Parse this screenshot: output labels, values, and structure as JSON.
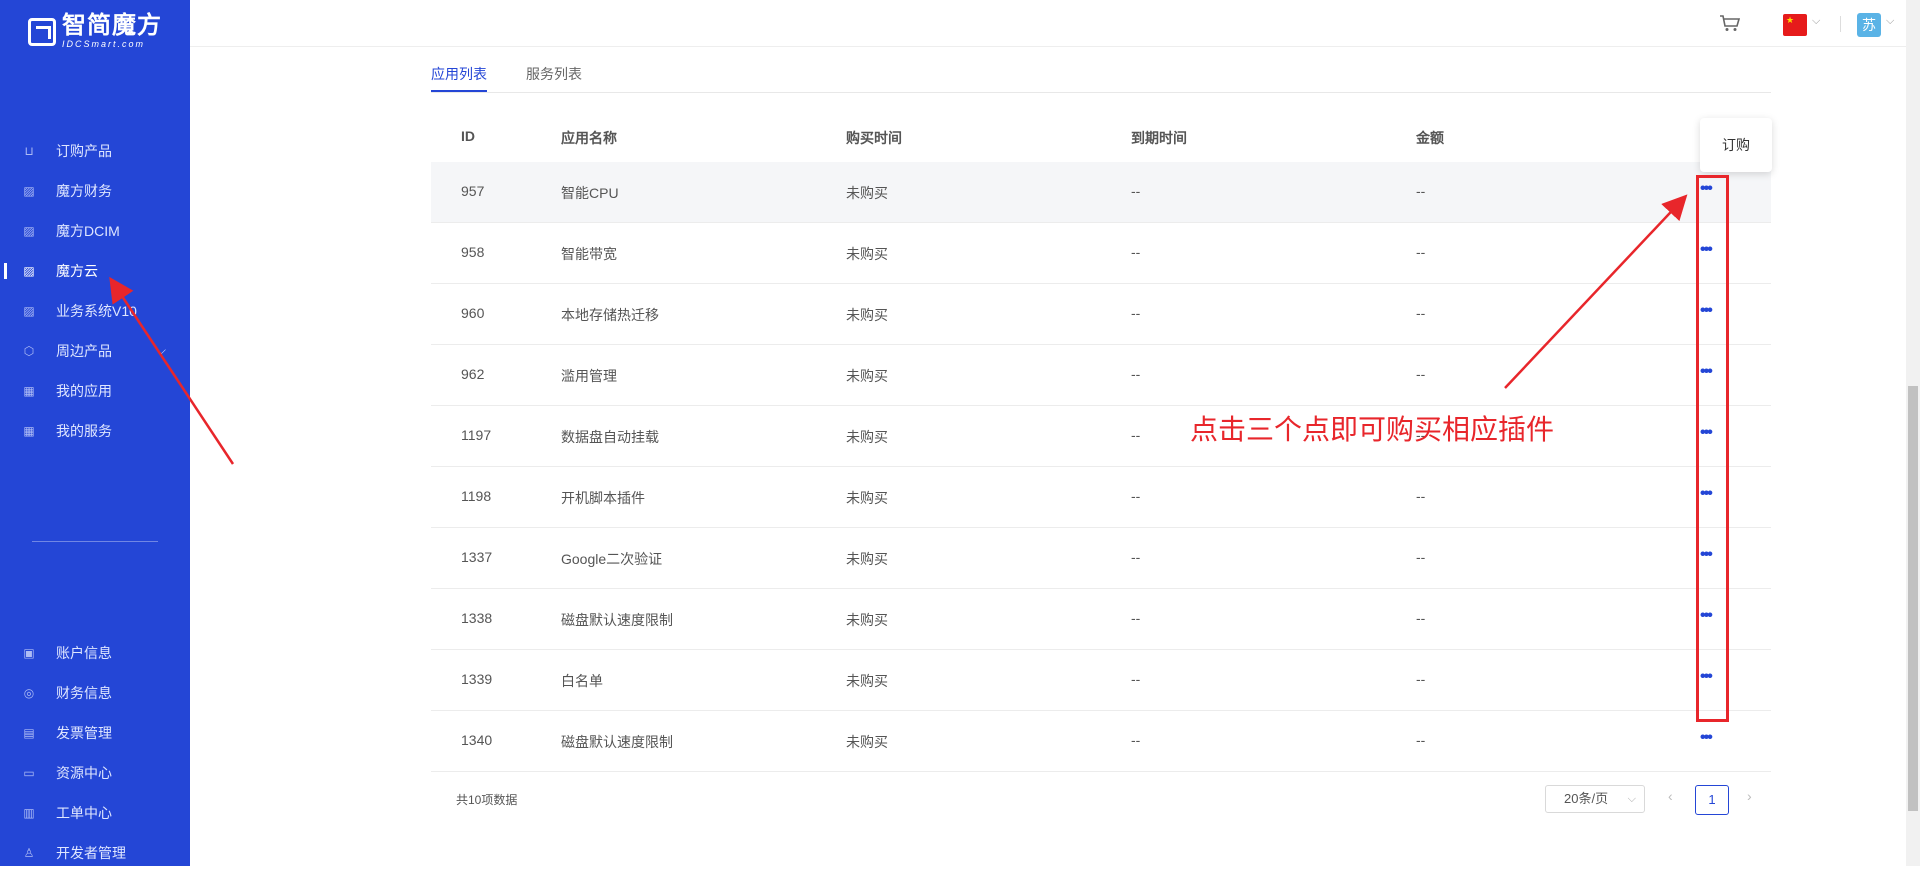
{
  "brand": {
    "title": "智简魔方",
    "subtitle": "IDCSmart.com"
  },
  "sidebar": {
    "top_items": [
      {
        "label": "订购产品",
        "icon": "cart-icon"
      },
      {
        "label": "魔方财务",
        "icon": "logo-icon"
      },
      {
        "label": "魔方DCIM",
        "icon": "logo-icon"
      },
      {
        "label": "魔方云",
        "icon": "logo-icon",
        "active": true
      },
      {
        "label": "业务系统V10",
        "icon": "logo-icon"
      },
      {
        "label": "周边产品",
        "icon": "cube-icon",
        "expandable": true
      },
      {
        "label": "我的应用",
        "icon": "grid-icon"
      },
      {
        "label": "我的服务",
        "icon": "grid-icon"
      }
    ],
    "bottom_items": [
      {
        "label": "账户信息",
        "icon": "user-card-icon"
      },
      {
        "label": "财务信息",
        "icon": "yen-icon"
      },
      {
        "label": "发票管理",
        "icon": "invoice-icon"
      },
      {
        "label": "资源中心",
        "icon": "folder-icon"
      },
      {
        "label": "工单中心",
        "icon": "ticket-icon"
      },
      {
        "label": "开发者管理",
        "icon": "developer-icon"
      }
    ]
  },
  "header": {
    "avatar_text": "苏",
    "colors": {
      "accent": "#2446d6",
      "sidebar_bg": "#2446d6",
      "annotation": "#e8262b"
    }
  },
  "tabs": [
    {
      "label": "应用列表",
      "active": true
    },
    {
      "label": "服务列表"
    }
  ],
  "table": {
    "columns": [
      "ID",
      "应用名称",
      "购买时间",
      "到期时间",
      "金额"
    ],
    "rows": [
      {
        "id": "957",
        "name": "智能CPU",
        "buy": "未购买",
        "expire": "--",
        "amount": "--"
      },
      {
        "id": "958",
        "name": "智能带宽",
        "buy": "未购买",
        "expire": "--",
        "amount": "--"
      },
      {
        "id": "960",
        "name": "本地存储热迁移",
        "buy": "未购买",
        "expire": "--",
        "amount": "--"
      },
      {
        "id": "962",
        "name": "滥用管理",
        "buy": "未购买",
        "expire": "--",
        "amount": "--"
      },
      {
        "id": "1197",
        "name": "数据盘自动挂载",
        "buy": "未购买",
        "expire": "--",
        "amount": "--"
      },
      {
        "id": "1198",
        "name": "开机脚本插件",
        "buy": "未购买",
        "expire": "--",
        "amount": "--"
      },
      {
        "id": "1337",
        "name": "Google二次验证",
        "buy": "未购买",
        "expire": "--",
        "amount": "--"
      },
      {
        "id": "1338",
        "name": "磁盘默认速度限制",
        "buy": "未购买",
        "expire": "--",
        "amount": "--"
      },
      {
        "id": "1339",
        "name": "白名单",
        "buy": "未购买",
        "expire": "--",
        "amount": "--"
      },
      {
        "id": "1340",
        "name": "磁盘默认速度限制",
        "buy": "未购买",
        "expire": "--",
        "amount": "--"
      }
    ]
  },
  "popover": {
    "label": "订购"
  },
  "pagination": {
    "total_text": "共10项数据",
    "page_size": "20条/页",
    "current_page": "1"
  },
  "annotation": {
    "text": "点击三个点即可购买相应插件"
  }
}
